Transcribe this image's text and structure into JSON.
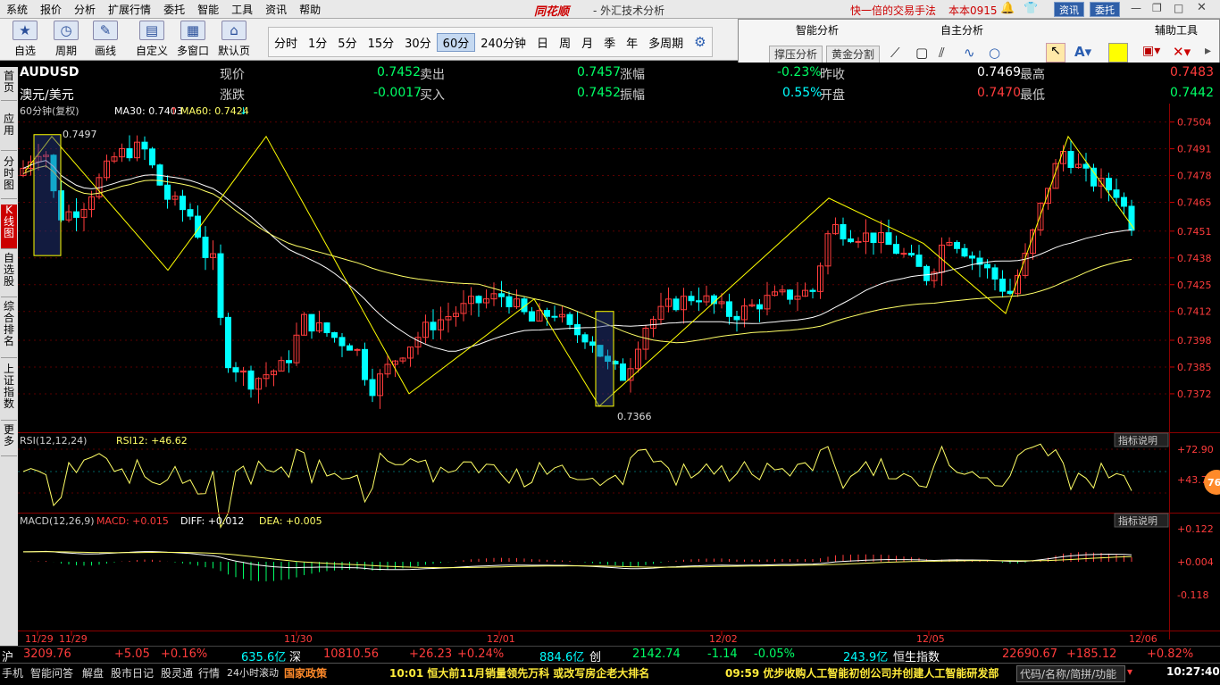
{
  "menu": [
    "系统",
    "报价",
    "分析",
    "扩展行情",
    "委托",
    "智能",
    "工具",
    "资讯",
    "帮助"
  ],
  "brand": "同花顺",
  "app_title": "- 外汇技术分析",
  "slogan": "快一倍的交易手法",
  "account": "本本0915",
  "top_buttons": {
    "news": "资讯",
    "trade": "委托"
  },
  "toolbar": {
    "groups": [
      {
        "label": "自选"
      },
      {
        "label": "周期"
      },
      {
        "label": "画线"
      },
      {
        "label": "自定义"
      },
      {
        "label": "多窗口"
      },
      {
        "label": "默认页"
      }
    ]
  },
  "periods": [
    "分时",
    "1分",
    "5分",
    "15分",
    "30分",
    "60分",
    "240分钟",
    "日",
    "周",
    "月",
    "季",
    "年",
    "多周期"
  ],
  "selected_period": "60分",
  "panel": {
    "smart": "智能分析",
    "self": "自主分析",
    "aux": "辅助工具",
    "btn1": "撑压分析",
    "btn2": "黄金分割"
  },
  "sidebar_tabs": [
    "首页",
    "应用",
    "分时图",
    "K线图",
    "自选股",
    "综合排名",
    "上证指数",
    "更多"
  ],
  "quote": {
    "code": "AUDUSD",
    "name": "澳元/美元",
    "items": [
      {
        "label": "现价",
        "value": "0.7452"
      },
      {
        "label": "卖出",
        "value": "0.7457"
      },
      {
        "label": "涨幅",
        "value": "-0.23%"
      },
      {
        "label": "昨收",
        "value": "0.7469"
      },
      {
        "label": "最高",
        "value": "0.7483"
      },
      {
        "label": "涨跌",
        "value": "-0.0017"
      },
      {
        "label": "买入",
        "value": "0.7452"
      },
      {
        "label": "振幅",
        "value": "0.55%"
      },
      {
        "label": "开盘",
        "value": "0.7470"
      },
      {
        "label": "最低",
        "value": "0.7442"
      }
    ]
  },
  "chart_data": {
    "type": "candlestick",
    "title": "60分钟(复权)",
    "indicators": {
      "ma30": "MA30: 0.7403",
      "ma60": "MA60: 0.7424"
    },
    "ylim": [
      0.7362,
      0.7506
    ],
    "y_ticks": [
      "0.7504",
      "0.7491",
      "0.7478",
      "0.7465",
      "0.7451",
      "0.7438",
      "0.7425",
      "0.7412",
      "0.7398",
      "0.7385",
      "0.7372"
    ],
    "x_ticks": [
      "11/29",
      "11/29",
      "11/30",
      "12/01",
      "12/02",
      "12/05",
      "12/06"
    ],
    "annotations": {
      "high": "0.7497",
      "low": "0.7366"
    },
    "rsi": {
      "label": "RSI(12,12,24)",
      "value": "RSI12: +46.62",
      "ticks": [
        "+72.90",
        "+43.79"
      ],
      "explain": "指标说明"
    },
    "macd": {
      "label": "MACD(12,26,9)",
      "macd": "MACD: +0.015",
      "diff": "DIFF: +0.012",
      "dea": "DEA: +0.005",
      "ticks": [
        "+0.122",
        "+0.004",
        "-0.118"
      ],
      "explain": "指标说明"
    },
    "badge": "76"
  },
  "status": {
    "sh": "沪",
    "sh_v": "3209.76",
    "sh_c": "+5.05",
    "sh_p": "+0.16%",
    "sh_amt": "635.6亿",
    "sz": "深",
    "sz_v": "10810.56",
    "sz_c": "+26.23",
    "sz_p": "+0.24%",
    "sz_amt": "884.6亿",
    "cy": "创",
    "cy_v": "2142.74",
    "cy_c": "-1.14",
    "cy_p": "-0.05%",
    "cy_amt": "243.9亿",
    "hs": "恒生指数",
    "hs_v": "22690.67",
    "hs_c": "+185.12",
    "hs_p": "+0.82%"
  },
  "taskbar": {
    "items": [
      "手机",
      "智能问答",
      "解盘",
      "股市日记",
      "股灵通",
      "行情",
      "24小时滚动",
      "国家政策"
    ],
    "news1": "10:01 恒大前11月销量领先万科 或改写房企老大排名",
    "news2": "09:59 优步收购人工智能初创公司并创建人工智能研发部",
    "search": "代码/名称/简拼/功能",
    "clock": "10:27:40"
  },
  "colors": {
    "up": "#ff3c3c",
    "down": "#00ffff",
    "ma30": "#ffffff",
    "ma60": "#ffff66",
    "zigzag": "#ffff00",
    "green": "#00ff66"
  }
}
